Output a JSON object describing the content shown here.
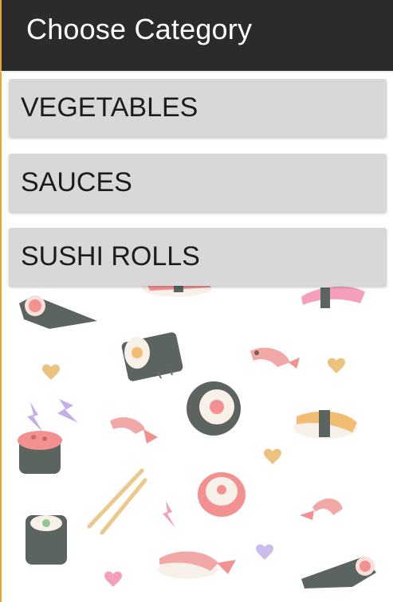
{
  "header": {
    "title": "Choose Category"
  },
  "categories": [
    {
      "label": "VEGETABLES"
    },
    {
      "label": "SAUCES"
    },
    {
      "label": "SUSHI ROLLS"
    }
  ],
  "background": {
    "pattern": "sushi-doodles",
    "icons": [
      "sushi-roll-icon",
      "nigiri-icon",
      "shrimp-icon",
      "heart-icon",
      "chopsticks-icon",
      "lightning-icon",
      "temaki-icon"
    ]
  },
  "colors": {
    "titlebar": "#2b2b2b",
    "accent_edge": "#e0a82e",
    "button_bg": "#d8d8d8",
    "seaweed": "#3f4a44",
    "salmon": "#f27e7e",
    "pink": "#f38fb0",
    "heart": "#e8b86a",
    "purple": "#b9a2e6"
  }
}
